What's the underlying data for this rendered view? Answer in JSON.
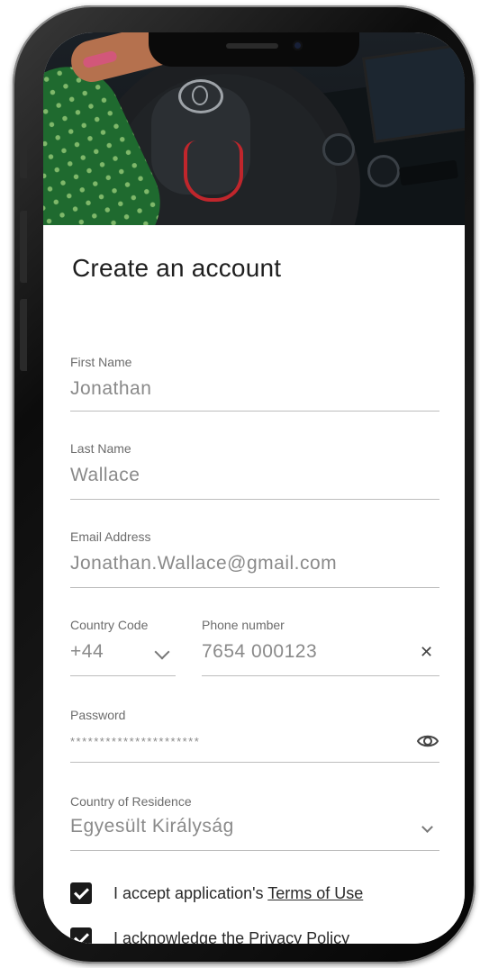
{
  "form": {
    "title": "Create an account",
    "first_name": {
      "label": "First Name",
      "value": "Jonathan"
    },
    "last_name": {
      "label": "Last Name",
      "value": "Wallace"
    },
    "email": {
      "label": "Email Address",
      "value": "Jonathan.Wallace@gmail.com"
    },
    "country_code": {
      "label": "Country Code",
      "value": "+44"
    },
    "phone": {
      "label": "Phone number",
      "value": "7654 000123"
    },
    "password": {
      "label": "Password",
      "value": "**********************"
    },
    "residence": {
      "label": "Country of Residence",
      "value": "Egyesült Királyság"
    },
    "terms": {
      "prefix": "I accept application's ",
      "link": "Terms of Use",
      "checked": true
    },
    "privacy": {
      "prefix": "I acknowledge the ",
      "link": "Privacy Policy",
      "checked": true
    }
  },
  "icons": {
    "clear": "close-icon",
    "password_toggle": "eye-icon",
    "dropdown": "chevron-down-icon",
    "checkbox": "checkmark-icon"
  }
}
